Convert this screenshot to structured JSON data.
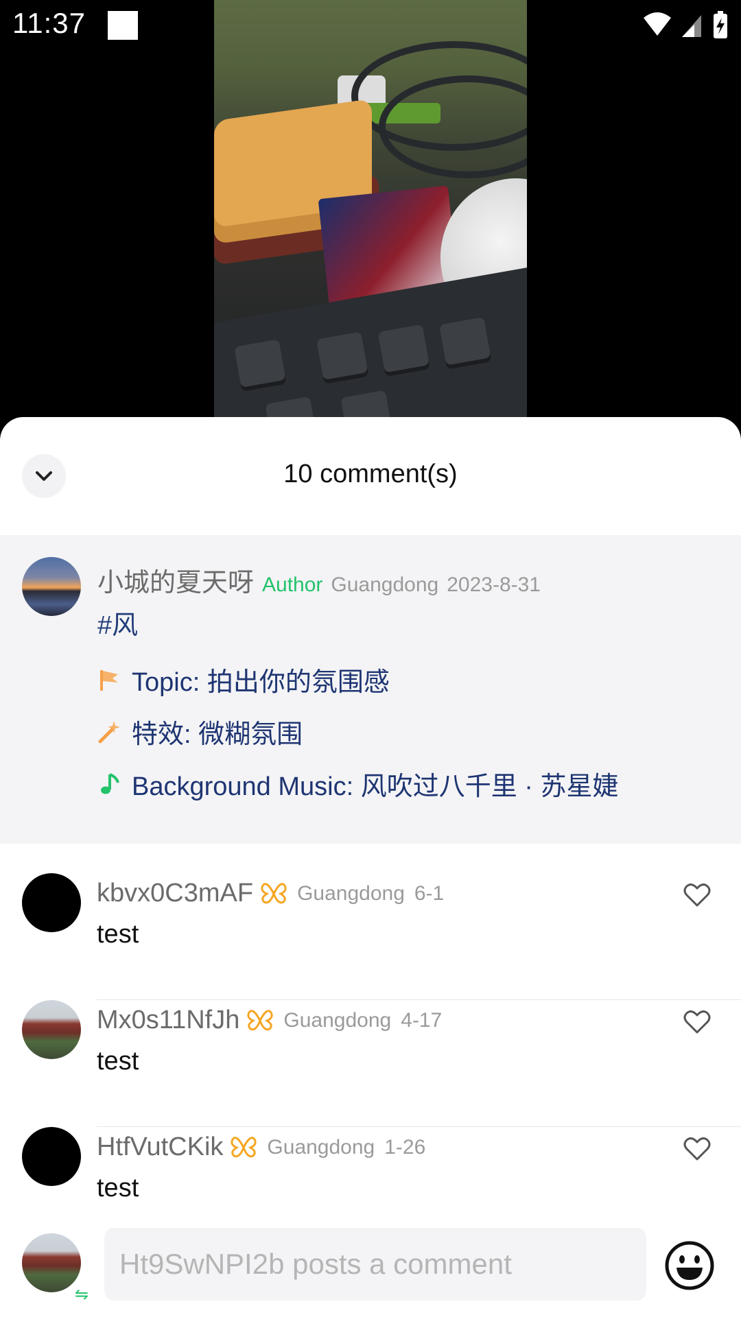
{
  "status_bar": {
    "time": "11:37"
  },
  "sheet": {
    "title": "10 comment(s)"
  },
  "author_post": {
    "name": "小城的夏天呀",
    "badge": "Author",
    "location": "Guangdong",
    "date": "2023-8-31",
    "hashtag": "#风",
    "topic": "Topic: 拍出你的氛围感",
    "effect": "特效: 微糊氛围",
    "music": "Background Music: 风吹过八千里 · 苏星婕"
  },
  "comments": [
    {
      "name": "kbvx0C3mAF",
      "location": "Guangdong",
      "date": "6-1",
      "text": "test"
    },
    {
      "name": "Mx0s11NfJh",
      "location": "Guangdong",
      "date": "4-17",
      "text": "test"
    },
    {
      "name": "HtfVutCKik",
      "location": "Guangdong",
      "date": "1-26",
      "text": "test"
    }
  ],
  "composer": {
    "placeholder": "Ht9SwNPI2b posts a comment"
  },
  "colors": {
    "author_tag": "#23c26b",
    "link_text": "#1e3572",
    "badge_gold": "#f5a623"
  }
}
